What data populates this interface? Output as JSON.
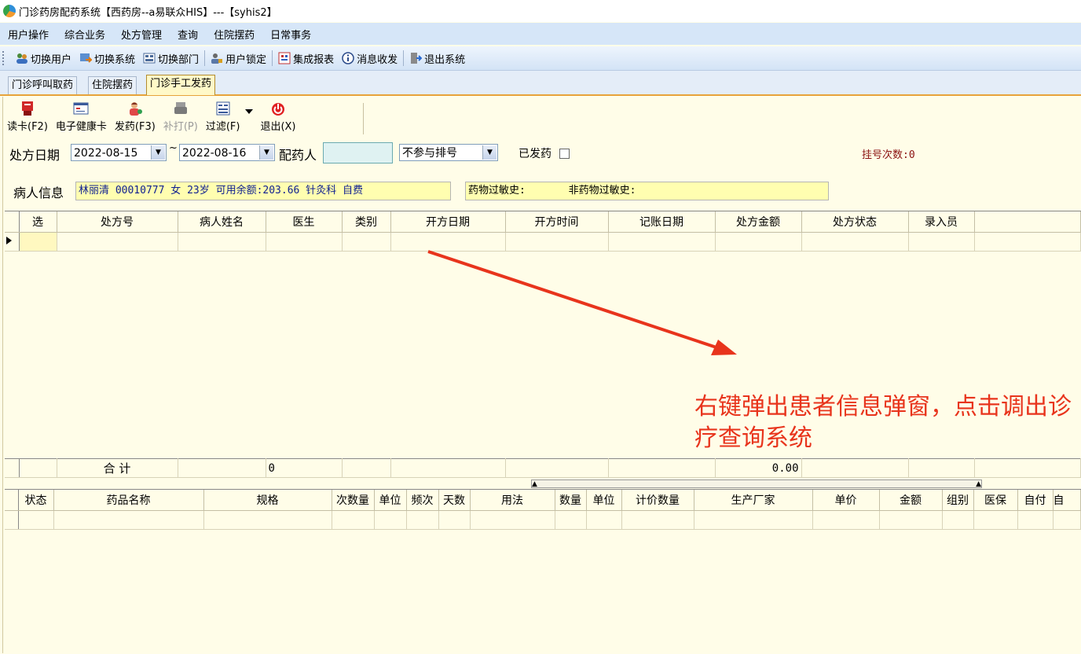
{
  "window": {
    "title": "门诊药房配药系统【西药房--a易联众HIS】---【syhis2】"
  },
  "menu": [
    "用户操作",
    "综合业务",
    "处方管理",
    "查询",
    "住院摆药",
    "日常事务"
  ],
  "toolbar": {
    "switch_user": "切换用户",
    "switch_system": "切换系统",
    "switch_dept": "切换部门",
    "user_lock": "用户锁定",
    "report": "集成报表",
    "messages": "消息收发",
    "exit_system": "退出系统"
  },
  "tabs": [
    "门诊呼叫取药",
    "住院摆药",
    "门诊手工发药"
  ],
  "actions": {
    "read_card": "读卡(F2)",
    "health_card": "电子健康卡",
    "dispense": "发药(F3)",
    "reprint": "补打(P)",
    "filter": "过滤(F)",
    "exit": "退出(X)"
  },
  "filter": {
    "date_label": "处方日期",
    "date_from": "2022-08-15",
    "tilde": "~",
    "date_to": "2022-08-16",
    "dispenser_label": "配药人",
    "dispenser_value": "",
    "queue_option": "不参与排号",
    "dispensed_label": "已发药",
    "registration_count": "挂号次数:0"
  },
  "patient": {
    "label": "病人信息",
    "info": "林丽清 00010777 女 23岁 可用余额:203.66 针灸科 自费",
    "allergy": "药物过敏史:       非药物过敏史:"
  },
  "prescription_table": {
    "headers": [
      "选",
      "处方号",
      "病人姓名",
      "医生",
      "类别",
      "开方日期",
      "开方时间",
      "记账日期",
      "处方金额",
      "处方状态",
      "录入员"
    ],
    "sum_label": "合  计",
    "sum_count": "0",
    "sum_amount": "0.00"
  },
  "drug_table": {
    "headers": [
      "状态",
      "药品名称",
      "规格",
      "次数量",
      "单位",
      "频次",
      "天数",
      "用法",
      "数量",
      "单位",
      "计价数量",
      "生产厂家",
      "单价",
      "金额",
      "组别",
      "医保",
      "自付",
      "自"
    ]
  },
  "annotation": {
    "text": "右键弹出患者信息弹窗，点击调出诊疗查询系统",
    "color": "#e8341c"
  }
}
